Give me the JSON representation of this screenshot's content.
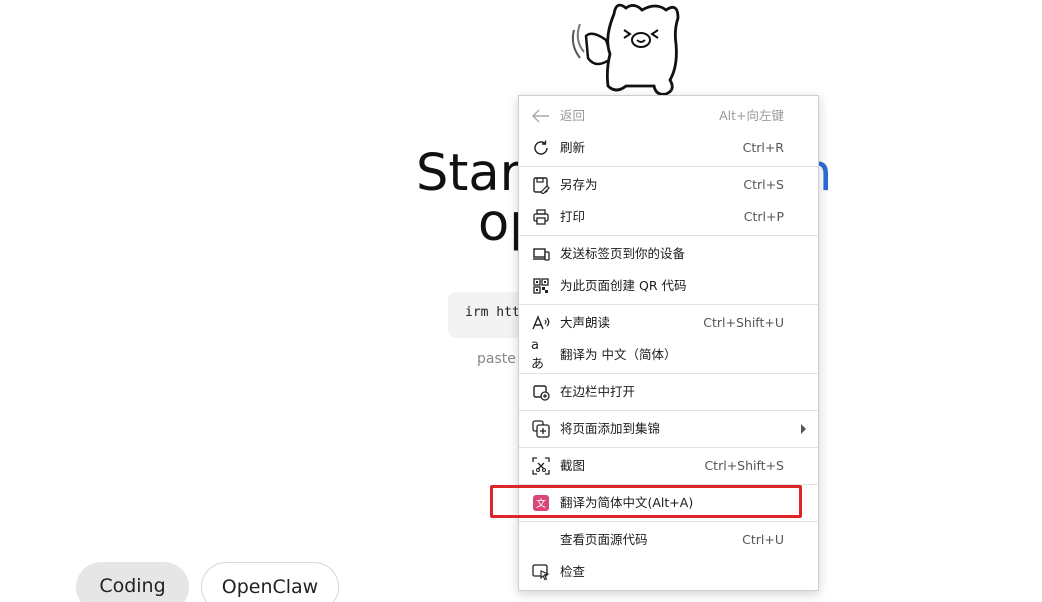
{
  "page": {
    "hero_line1": "Start",
    "hero_tail": "h",
    "hero_line2": "op",
    "command_text": "irm htt",
    "paste_hint": "paste",
    "tabs": [
      {
        "label": "Coding",
        "selected": true
      },
      {
        "label": "OpenClaw",
        "selected": false
      }
    ]
  },
  "context_menu": {
    "items": [
      {
        "label": "返回",
        "shortcut": "Alt+向左键",
        "icon": "back-arrow-icon",
        "disabled": true
      },
      {
        "label": "刷新",
        "shortcut": "Ctrl+R",
        "icon": "refresh-icon"
      },
      {
        "label": "另存为",
        "shortcut": "Ctrl+S",
        "icon": "save-as-icon"
      },
      {
        "label": "打印",
        "shortcut": "Ctrl+P",
        "icon": "print-icon"
      },
      {
        "label": "发送标签页到你的设备",
        "shortcut": "",
        "icon": "send-to-device-icon"
      },
      {
        "label": "为此页面创建 QR 代码",
        "shortcut": "",
        "icon": "qr-code-icon"
      },
      {
        "label": "大声朗读",
        "shortcut": "Ctrl+Shift+U",
        "icon": "read-aloud-icon"
      },
      {
        "label": "翻译为 中文（简体）",
        "shortcut": "",
        "icon": "translate-icon"
      },
      {
        "label": "在边栏中打开",
        "shortcut": "",
        "icon": "open-in-sidebar-icon"
      },
      {
        "label": "将页面添加到集锦",
        "shortcut": "",
        "icon": "add-to-collections-icon",
        "submenu": true
      },
      {
        "label": "截图",
        "shortcut": "Ctrl+Shift+S",
        "icon": "screenshot-icon"
      },
      {
        "label": "翻译为简体中文(Alt+A)",
        "shortcut": "",
        "icon": "translate-extension-icon",
        "highlighted": true
      },
      {
        "label": "查看页面源代码",
        "shortcut": "Ctrl+U",
        "icon": ""
      },
      {
        "label": "检查",
        "shortcut": "",
        "icon": "inspect-icon"
      }
    ]
  },
  "colors": {
    "highlight_border": "#e0242c",
    "hero_accent": "#2d6bd6",
    "translate_extension_icon": "#d9467a"
  }
}
